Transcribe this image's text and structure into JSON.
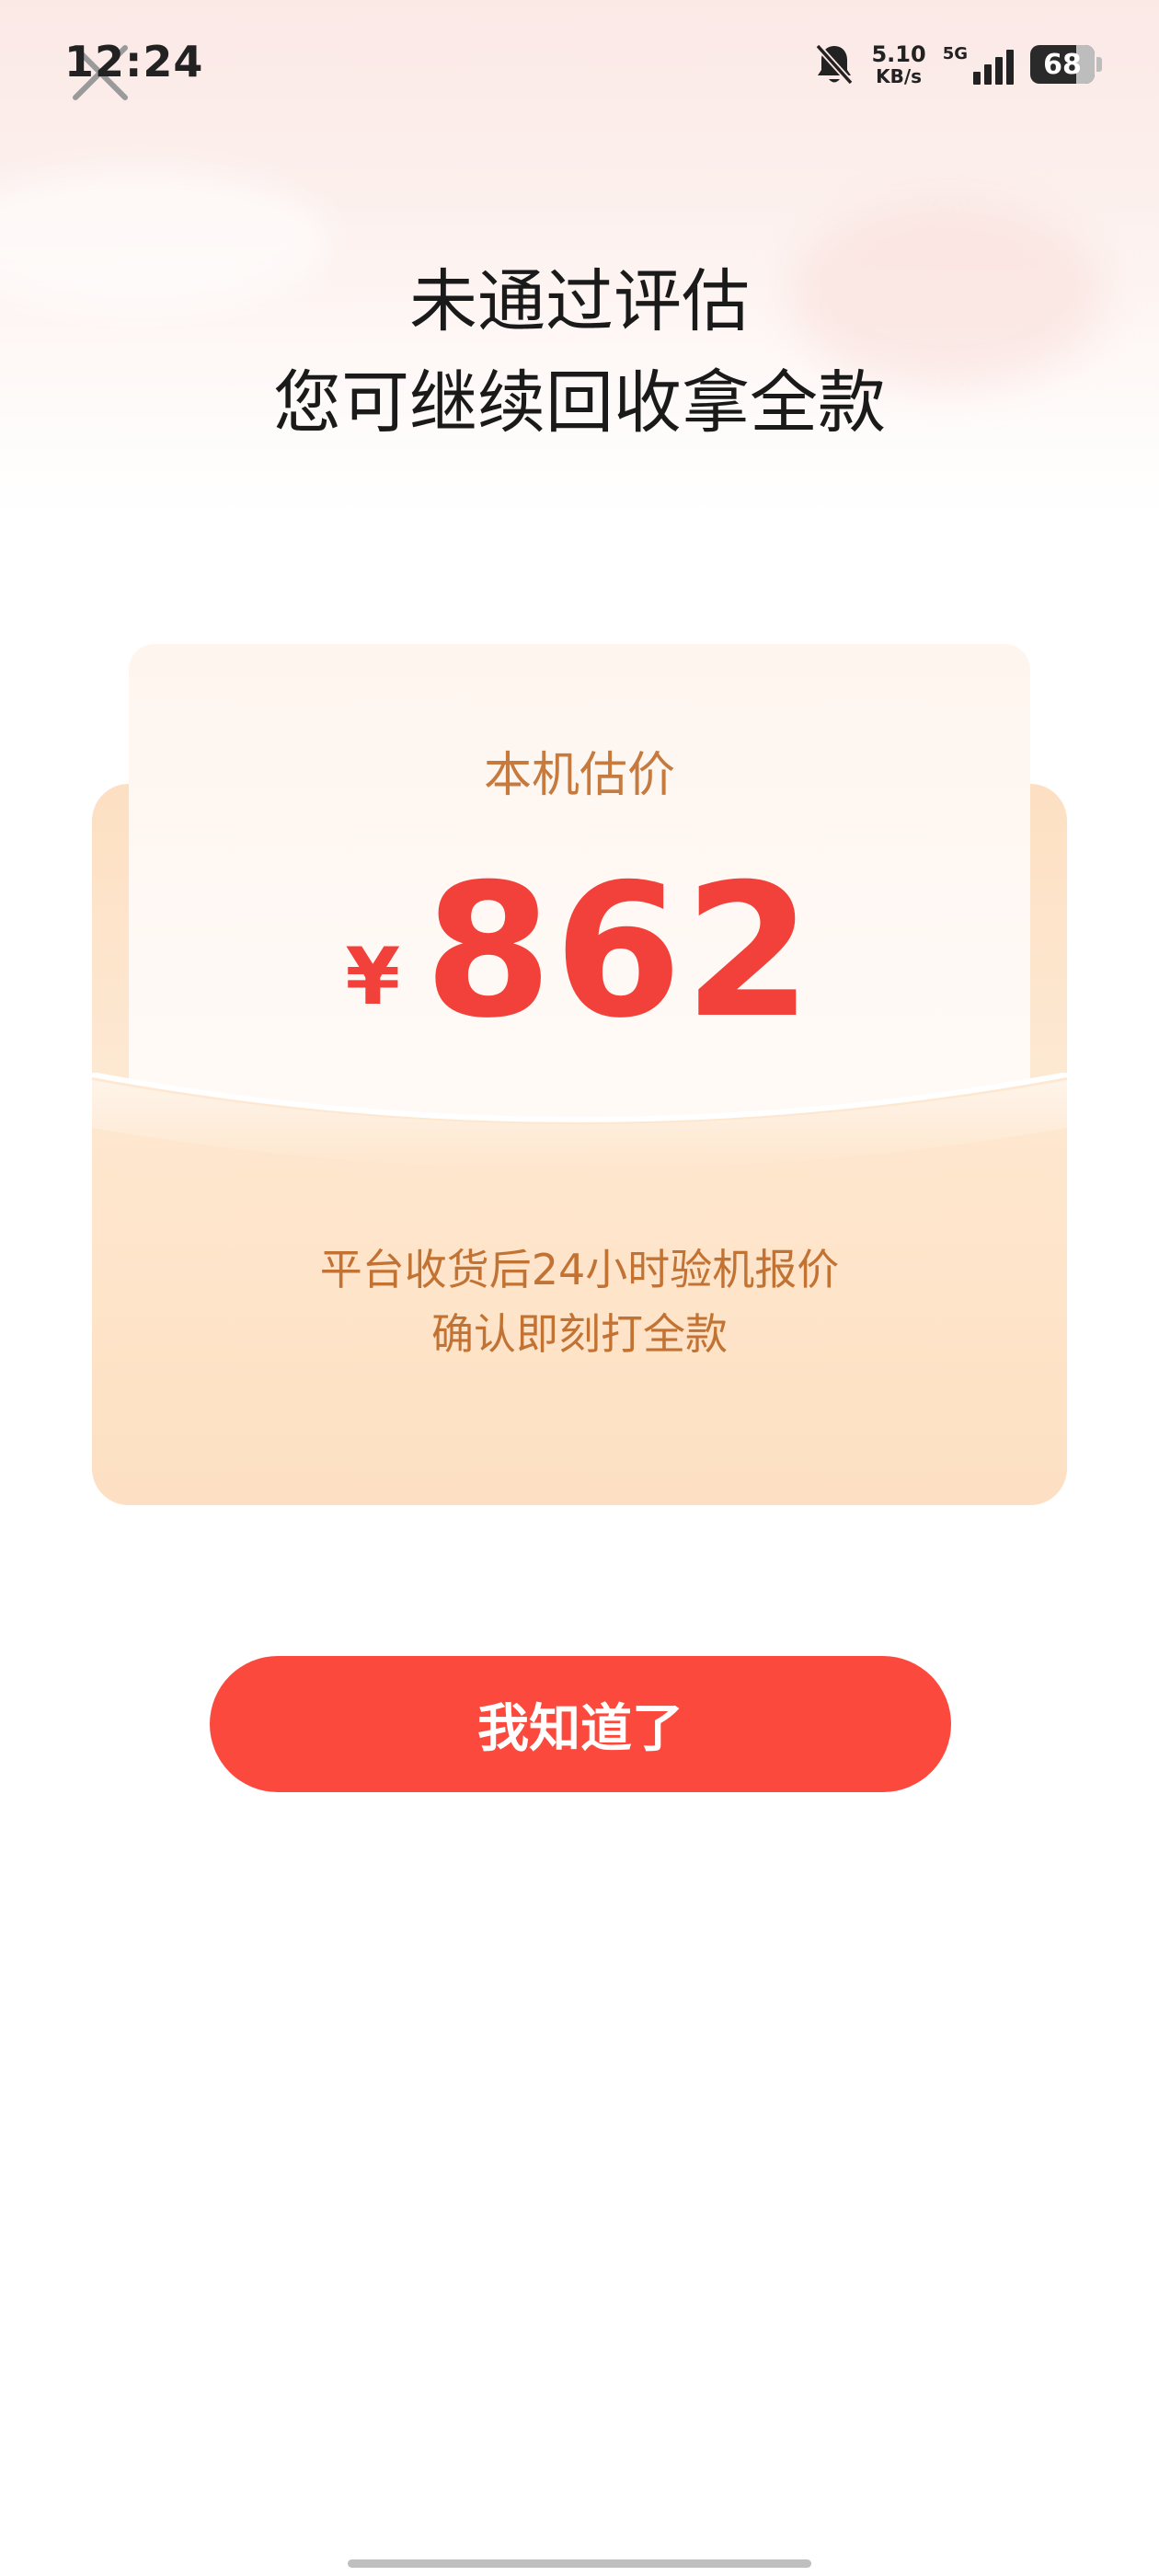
{
  "status_bar": {
    "time": "12:24",
    "net_speed_value": "5.10",
    "net_speed_unit": "KB/s",
    "network_type": "5G",
    "battery_level": "68"
  },
  "header": {
    "title_line1": "未通过评估",
    "title_line2": "您可继续回收拿全款"
  },
  "card": {
    "label": "本机估价",
    "currency": "¥",
    "price": "862",
    "note_line1": "平台收货后24小时验机报价",
    "note_line2": "确认即刻打全款"
  },
  "actions": {
    "confirm_label": "我知道了"
  },
  "icons": {
    "close": "close-icon",
    "mute": "bell-off-icon",
    "signal": "signal-bars-icon",
    "battery": "battery-icon"
  },
  "colors": {
    "accent_red": "#fb4a3d",
    "price_red": "#f2413a",
    "label_orange": "#c67a3e",
    "card_cream": "#fde8d2"
  }
}
